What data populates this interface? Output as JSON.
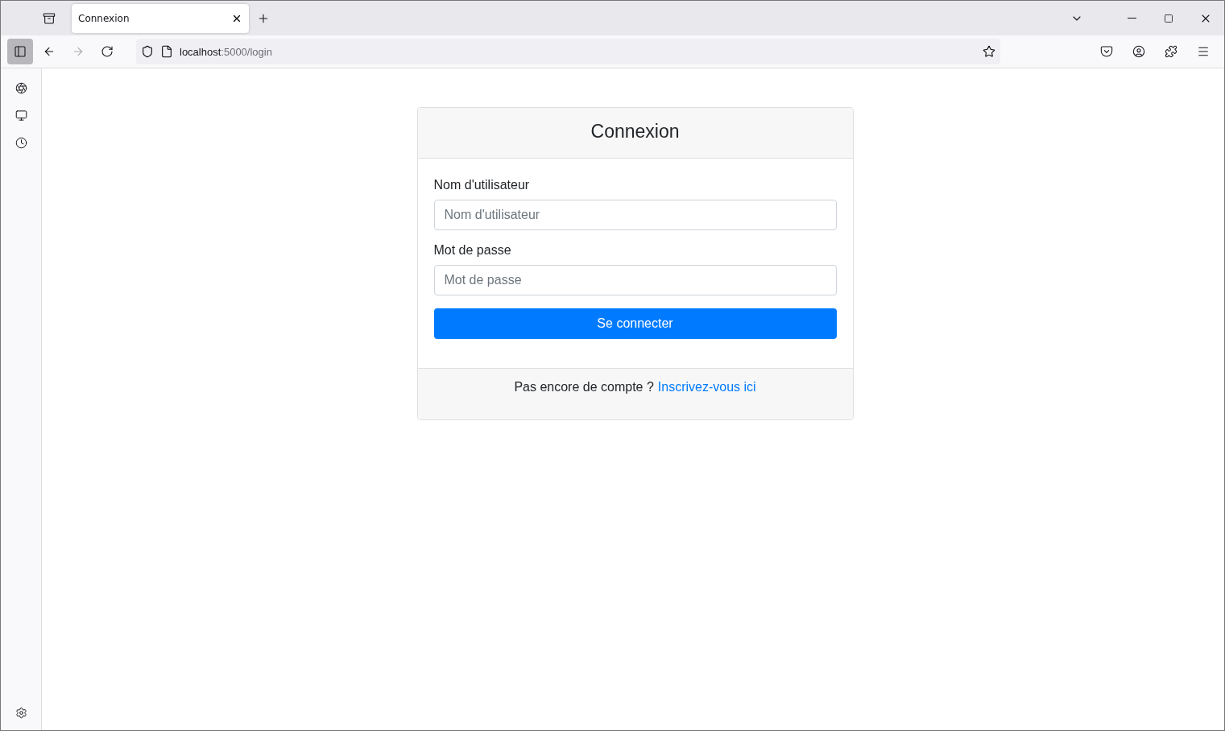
{
  "browser": {
    "tab": {
      "title": "Connexion",
      "selected": true
    },
    "url": {
      "host": "localhost",
      "path": ":5000/login"
    }
  },
  "login": {
    "title": "Connexion",
    "fields": [
      {
        "label": "Nom d'utilisateur",
        "placeholder": "Nom d'utilisateur"
      },
      {
        "label": "Mot de passe",
        "placeholder": "Mot de passe"
      }
    ],
    "submit": "Se connecter",
    "footer": {
      "text": "Pas encore de compte ?",
      "link": "Inscrivez-vous ici"
    }
  }
}
